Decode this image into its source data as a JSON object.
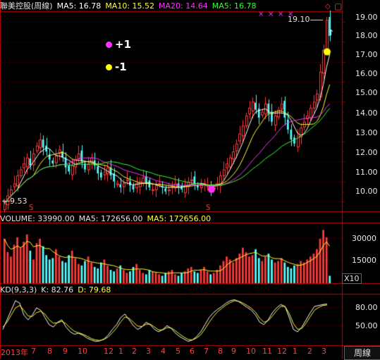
{
  "header": {
    "stock": "聯美控股(周線)",
    "ma5": "MA5: 16.78",
    "ma10": "MA10: 15.52",
    "ma20": "MA20: 14.64",
    "ma5b": "MA5: 16.78"
  },
  "legend": {
    "plus": "+1",
    "minus": "-1"
  },
  "annotations": {
    "high": "19.10",
    "low": "9.53"
  },
  "volume_header": {
    "label": "VOLUME: 33990.00",
    "ma5": "MA5: 172656.00",
    "ma5b": "MA5: 172656.00"
  },
  "kd_header": {
    "label": "KD(9,3,3)",
    "k": "K: 82.76",
    "d": "D: 79.68"
  },
  "y_axis_price": [
    "19.00",
    "18.00",
    "17.00",
    "16.00",
    "15.00",
    "14.00",
    "13.00",
    "12.00",
    "11.00",
    "10.00"
  ],
  "y_axis_volume": [
    "30000",
    "15000"
  ],
  "volume_unit": "X10",
  "y_axis_kd": [
    "80.00",
    "50.00"
  ],
  "x_axis": [
    "2013年",
    "7",
    "8",
    "9",
    "10",
    "12",
    "1",
    "2",
    "3",
    "4",
    "5",
    "6",
    "7",
    "8",
    "9",
    "10",
    "11",
    "12",
    "1",
    "2",
    "3"
  ],
  "timeframe": "周線",
  "colors": {
    "up": "#ff3b3b",
    "down": "#54ffff",
    "ma5": "#ffffff",
    "ma10": "#ffff33",
    "ma20": "#ff33ff",
    "ma30": "#33ff33",
    "grid": "#7a0000",
    "axis": "#c00000"
  },
  "chart_data": {
    "type": "candlestick",
    "price_range": [
      9.5,
      19.5
    ],
    "closes": [
      9.9,
      10.3,
      10.6,
      10.9,
      11.3,
      11.6,
      11.9,
      12.2,
      11.8,
      12.4,
      12.8,
      13.1,
      12.7,
      12.5,
      12.1,
      11.9,
      12.3,
      12.6,
      12.2,
      11.7,
      11.5,
      11.8,
      12.1,
      12.4,
      12.0,
      11.6,
      11.9,
      12.2,
      11.8,
      11.4,
      11.2,
      11.5,
      11.7,
      11.3,
      11.0,
      10.9,
      10.7,
      10.9,
      11.1,
      10.8,
      10.6,
      10.9,
      11.0,
      11.2,
      10.9,
      10.7,
      10.6,
      10.8,
      10.9,
      10.7,
      10.5,
      10.6,
      10.8,
      10.9,
      10.7,
      10.6,
      10.8,
      11.0,
      11.1,
      10.9,
      10.7,
      10.8,
      10.9,
      10.8,
      10.6,
      10.7,
      10.9,
      11.3,
      11.6,
      11.9,
      12.2,
      12.5,
      12.9,
      13.4,
      13.8,
      14.3,
      14.7,
      15.0,
      14.6,
      14.2,
      14.5,
      14.9,
      14.4,
      14.0,
      14.3,
      14.6,
      14.9,
      14.2,
      13.6,
      13.1,
      12.9,
      13.3,
      13.7,
      14.0,
      14.3,
      14.7,
      15.0,
      15.4,
      16.5,
      17.6,
      19.1,
      18.3
    ],
    "volume": [
      3000,
      2100,
      1800,
      2600,
      3100,
      2400,
      2800,
      3300,
      2200,
      1600,
      2700,
      3000,
      2500,
      1900,
      1600,
      1700,
      2300,
      1800,
      1500,
      1400,
      1900,
      2200,
      1700,
      1300,
      1200,
      1500,
      1800,
      1400,
      1100,
      1000,
      1400,
      1600,
      1200,
      900,
      800,
      1000,
      1200,
      900,
      700,
      800,
      1100,
      1300,
      900,
      700,
      600,
      900,
      800,
      700,
      600,
      500,
      700,
      800,
      900,
      600,
      500,
      700,
      800,
      1000,
      1100,
      800,
      700,
      900,
      1100,
      800,
      600,
      700,
      900,
      1200,
      1500,
      1800,
      1600,
      1400,
      1700,
      2000,
      2400,
      2100,
      1800,
      1900,
      2300,
      1700,
      1500,
      1800,
      2000,
      1600,
      1400,
      1500,
      1700,
      1400,
      1100,
      1000,
      1200,
      1300,
      1500,
      1400,
      1600,
      1800,
      2000,
      2300,
      3000,
      3600,
      3100,
      500
    ],
    "k": [
      0.3,
      0.5,
      0.7,
      0.9,
      0.85,
      0.6,
      0.5,
      0.6,
      0.75,
      0.7,
      0.55,
      0.4,
      0.35,
      0.45,
      0.5,
      0.35,
      0.25,
      0.2,
      0.22,
      0.18,
      0.12,
      0.08,
      0.05,
      0.06,
      0.1,
      0.18,
      0.3,
      0.4,
      0.55,
      0.62,
      0.5,
      0.38,
      0.3,
      0.35,
      0.45,
      0.4,
      0.3,
      0.25,
      0.3,
      0.38,
      0.32,
      0.22,
      0.15,
      0.1,
      0.05,
      0.08,
      0.15,
      0.25,
      0.4,
      0.55,
      0.65,
      0.72,
      0.78,
      0.85,
      0.9,
      0.92,
      0.88,
      0.82,
      0.76,
      0.7,
      0.6,
      0.45,
      0.4,
      0.5,
      0.65,
      0.75,
      0.82,
      0.78,
      0.55,
      0.3,
      0.25,
      0.35,
      0.5,
      0.65,
      0.78,
      0.8,
      0.82,
      0.83
    ],
    "d": [
      0.35,
      0.45,
      0.6,
      0.75,
      0.8,
      0.7,
      0.58,
      0.57,
      0.65,
      0.68,
      0.62,
      0.5,
      0.43,
      0.44,
      0.47,
      0.42,
      0.33,
      0.26,
      0.23,
      0.2,
      0.16,
      0.11,
      0.08,
      0.07,
      0.09,
      0.14,
      0.23,
      0.33,
      0.46,
      0.56,
      0.53,
      0.45,
      0.37,
      0.36,
      0.41,
      0.41,
      0.35,
      0.29,
      0.29,
      0.34,
      0.33,
      0.27,
      0.2,
      0.14,
      0.09,
      0.08,
      0.12,
      0.19,
      0.31,
      0.45,
      0.57,
      0.67,
      0.74,
      0.81,
      0.86,
      0.9,
      0.89,
      0.85,
      0.8,
      0.74,
      0.66,
      0.53,
      0.45,
      0.48,
      0.58,
      0.69,
      0.78,
      0.78,
      0.63,
      0.42,
      0.3,
      0.32,
      0.43,
      0.57,
      0.7,
      0.76,
      0.8,
      0.81
    ]
  }
}
